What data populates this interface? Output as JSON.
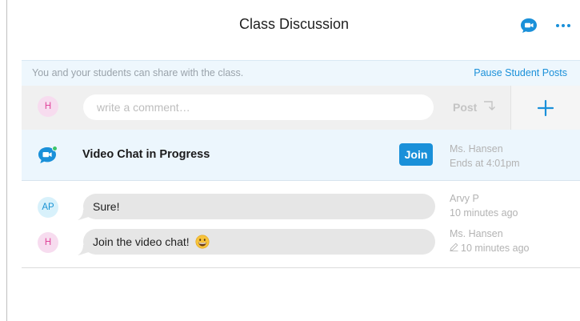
{
  "header": {
    "title": "Class Discussion",
    "video_icon": "video-chat-bubble-icon",
    "more_icon": "ellipsis-icon"
  },
  "info_bar": {
    "text": "You and your students can share with the class.",
    "pause_label": "Pause Student Posts"
  },
  "compose": {
    "avatar_initials": "H",
    "placeholder": "write a comment…",
    "value": "",
    "post_label": "Post",
    "post_icon": "return-arrow-icon",
    "add_icon": "plus-icon"
  },
  "video_chat": {
    "icon": "video-chat-bubble-icon",
    "title": "Video Chat in Progress",
    "join_label": "Join",
    "host": "Ms. Hansen",
    "ends": "Ends at 4:01pm"
  },
  "messages": [
    {
      "initials": "AP",
      "text": "Sure!",
      "author": "Arvy P",
      "time": "10 minutes ago",
      "edited": false
    },
    {
      "initials": "H",
      "text": "Join the video chat!",
      "emoji": "grinning-face-emoji",
      "author": "Ms. Hansen",
      "time": "10 minutes ago",
      "edited": true,
      "edit_icon": "pencil-icon"
    }
  ],
  "colors": {
    "accent": "#1a90d9",
    "avatar_h_bg": "#f7dcef",
    "avatar_h_text": "#e0449a",
    "avatar_ap_bg": "#d8f1fb",
    "avatar_ap_text": "#1a93d4",
    "info_bar_bg": "#eef7fd",
    "bubble_bg": "#e6e6e6"
  }
}
